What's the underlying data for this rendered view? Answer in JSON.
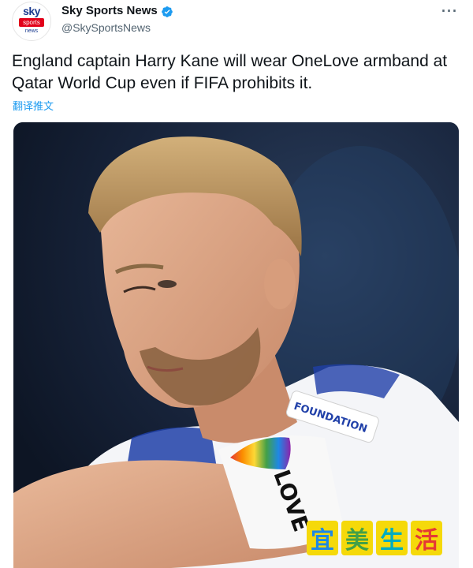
{
  "account": {
    "name": "Sky Sports News",
    "handle": "@SkySportsNews",
    "avatar": {
      "line1": "sky",
      "line2": "sports",
      "line3": "news"
    }
  },
  "tweet": {
    "text": "England captain Harry Kane will wear OneLove armband at Qatar World Cup even if FIFA prohibits it.",
    "translate_label": "翻译推文"
  },
  "more_label": "···",
  "image": {
    "patch_text": "FOUNDATION",
    "armband_text": "LOVE"
  },
  "watermark": [
    "宜",
    "美",
    "生",
    "活"
  ],
  "colors": {
    "verified": "#1d9bf0",
    "link": "#1d9bf0",
    "watermark_bg": "#f5d90a",
    "watermark_fg": [
      "#1e88e5",
      "#43a047",
      "#00acc1",
      "#e53935"
    ]
  }
}
